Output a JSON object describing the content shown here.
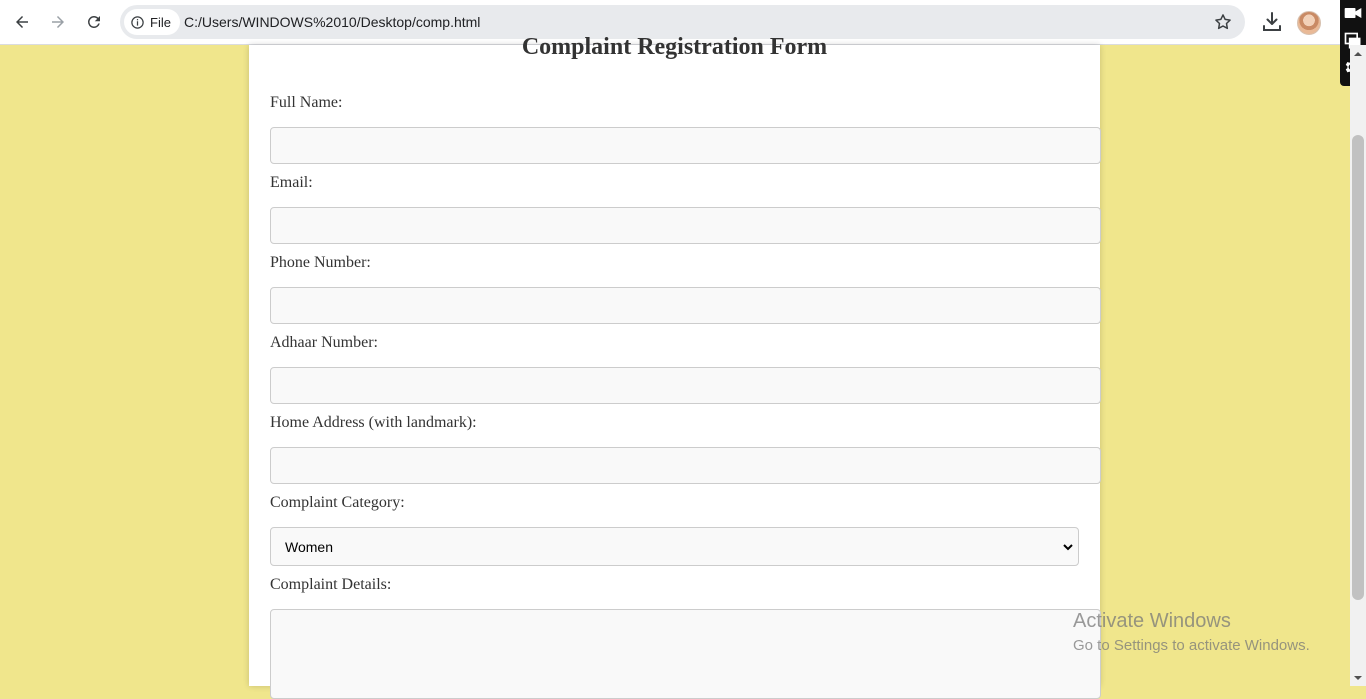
{
  "browser": {
    "site_chip": "File",
    "url": "C:/Users/WINDOWS%2010/Desktop/comp.html"
  },
  "form": {
    "title": "Complaint Registration Form",
    "fields": {
      "full_name": {
        "label": "Full Name:",
        "value": ""
      },
      "email": {
        "label": "Email:",
        "value": ""
      },
      "phone": {
        "label": "Phone Number:",
        "value": ""
      },
      "adhaar": {
        "label": "Adhaar Number:",
        "value": ""
      },
      "address": {
        "label": "Home Address (with landmark):",
        "value": ""
      },
      "category": {
        "label": "Complaint Category:",
        "selected": "Women"
      },
      "details": {
        "label": "Complaint Details:",
        "value": ""
      }
    }
  },
  "watermark": {
    "line1": "Activate Windows",
    "line2": "Go to Settings to activate Windows."
  }
}
